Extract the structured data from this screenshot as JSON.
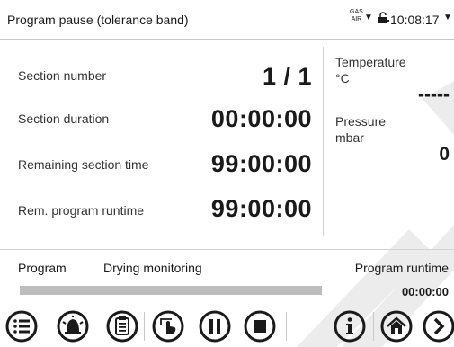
{
  "header": {
    "title": "Program pause (tolerance band)",
    "gas_top": "GAS",
    "gas_bottom": "AIR",
    "time": "10:08:17"
  },
  "left_panel": {
    "section_number_label": "Section number",
    "section_number_value": "1 / 1",
    "section_duration_label": "Section duration",
    "section_duration_value": "00:00:00",
    "remaining_section_time_label": "Remaining section time",
    "remaining_section_time_value": "99:00:00",
    "rem_program_runtime_label": "Rem. program runtime",
    "rem_program_runtime_value": "99:00:00"
  },
  "right_panel": {
    "temperature_label": "Temperature",
    "temperature_unit": "°C",
    "temperature_value": "-----",
    "pressure_label": "Pressure",
    "pressure_unit": "mbar",
    "pressure_value": "0"
  },
  "program": {
    "label": "Program",
    "name": "Drying monitoring",
    "runtime_label": "Program runtime",
    "runtime_value": "00:00:00"
  },
  "toolbar": {
    "icons": [
      "list-menu-icon",
      "alarm-icon",
      "clipboard-icon",
      "touch-icon",
      "pause-icon",
      "stop-icon",
      "info-icon",
      "home-icon",
      "next-arrow-icon"
    ]
  },
  "colors": {
    "icon_stroke": "#1a1a1a",
    "progress_bar": "#bdbdbd",
    "watermark": "#ececec"
  }
}
